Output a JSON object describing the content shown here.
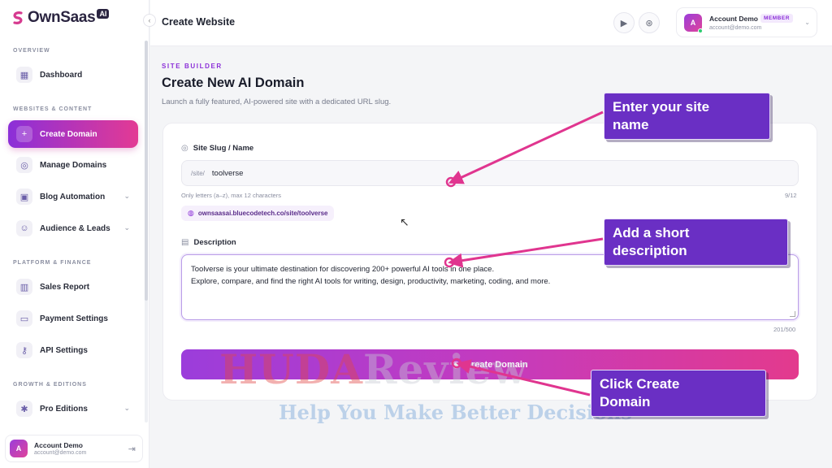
{
  "brand": {
    "name": "OwnSaas",
    "badge": "AI"
  },
  "sidebar": {
    "sections": [
      {
        "label": "OVERVIEW"
      },
      {
        "label": "WEBSITES & CONTENT"
      },
      {
        "label": "PLATFORM & FINANCE"
      },
      {
        "label": "GROWTH & EDITIONS"
      }
    ],
    "items": [
      {
        "label": "Dashboard",
        "icon": "grid-icon"
      },
      {
        "label": "Create Domain",
        "icon": "plus-icon",
        "active": true
      },
      {
        "label": "Manage Domains",
        "icon": "globe-icon"
      },
      {
        "label": "Blog Automation",
        "icon": "briefcase-icon"
      },
      {
        "label": "Audience & Leads",
        "icon": "users-icon"
      },
      {
        "label": "Sales Report",
        "icon": "bar-chart-icon"
      },
      {
        "label": "Payment Settings",
        "icon": "credit-card-icon"
      },
      {
        "label": "API Settings",
        "icon": "key-icon"
      },
      {
        "label": "Pro Editions",
        "icon": "sparkle-icon"
      }
    ],
    "account": {
      "initial": "A",
      "name": "Account Demo",
      "email": "account@demo.com"
    }
  },
  "topbar": {
    "title": "Create Website",
    "user": {
      "initial": "A",
      "name": "Account Demo",
      "badge": "MEMBER",
      "email": "account@demo.com"
    }
  },
  "main": {
    "kicker": "SITE BUILDER",
    "title": "Create New AI Domain",
    "subtitle": "Launch a fully featured, AI-powered site with a dedicated URL slug.",
    "slug": {
      "label": "Site Slug / Name",
      "prefix": "/site/",
      "value": "toolverse",
      "hint": "Only letters (a–z), max 12 characters",
      "counter": "9/12",
      "url": "ownsaasai.bluecodetech.co/site/toolverse"
    },
    "description": {
      "label": "Description",
      "line1": "Toolverse is your ultimate destination for discovering 200+ powerful AI tools in one place.",
      "line2": "Explore, compare, and find the right AI tools for writing, design, productivity, marketing, coding, and more.",
      "counter": "201/500"
    },
    "submit_label": "Create Domain"
  },
  "callouts": {
    "site_name": [
      "Enter your site",
      "name"
    ],
    "description": [
      "Add a short",
      "description"
    ],
    "create": [
      "Click Create",
      "Domain"
    ]
  },
  "watermark": {
    "brand_a": "HUDA",
    "brand_b": "Review",
    "tagline": "Help You Make Better Decisions"
  },
  "colors": {
    "accent_purple": "#8b2fd8",
    "accent_pink": "#e33a94",
    "callout_bg": "#6a2fc4",
    "arrow": "#e0358f"
  }
}
